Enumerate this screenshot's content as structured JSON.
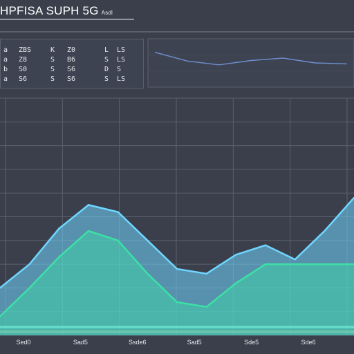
{
  "title": "HPFISA SUPH 5G",
  "subtitle": "Asdl",
  "table": {
    "rows": [
      [
        "a",
        "ZBS",
        "K",
        "Z0",
        "L",
        "LS"
      ],
      [
        "a",
        "Z8",
        "S",
        "B6",
        "S",
        "LS"
      ],
      [
        "b",
        "S0",
        "S",
        "S6",
        "D",
        "S"
      ],
      [
        "a",
        "S6",
        "S",
        "S6",
        "S",
        "LS"
      ]
    ]
  },
  "chart_data": [
    {
      "type": "line",
      "title": "",
      "x": [
        0,
        1,
        2,
        3,
        4,
        5,
        6,
        7,
        8,
        9,
        10,
        11,
        12
      ],
      "series": [
        {
          "values": [
            20,
            30,
            45,
            55,
            52,
            40,
            28,
            26,
            34,
            38,
            32,
            44,
            58
          ],
          "color": "#6fd6ff"
        },
        {
          "values": [
            8,
            20,
            33,
            44,
            40,
            26,
            14,
            12,
            22,
            30,
            30,
            30,
            30
          ],
          "color": "#3de0a6"
        }
      ],
      "bands": [
        {
          "from": 3,
          "to": 4,
          "color": "#bff5e6"
        },
        {
          "from": 1,
          "to": 2,
          "color": "#e0925c"
        }
      ],
      "xticklabels": [
        "Sed0",
        "Sad5",
        "Ssde6",
        "Sad5",
        "Sde5",
        "Sde6"
      ],
      "grid": true
    },
    {
      "type": "line",
      "title": "",
      "x": [
        0,
        1,
        2,
        3,
        4,
        5,
        6
      ],
      "series": [
        {
          "values": [
            72,
            54,
            46,
            55,
            60,
            50,
            48
          ],
          "color": "#6f8fd0"
        }
      ]
    }
  ]
}
